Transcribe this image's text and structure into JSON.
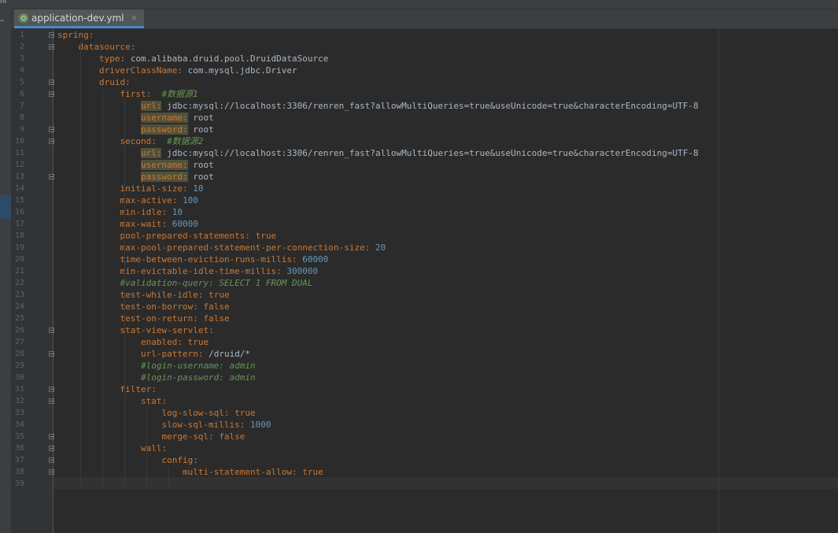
{
  "topbar": {
    "mark": "nl"
  },
  "left_strip": {
    "mark": "–"
  },
  "tab": {
    "title": "application-dev.yml",
    "close_glyph": "×",
    "icon": "spring-leaf-icon",
    "accent": "#4a88c7"
  },
  "colors": {
    "background": "#2b2b2b",
    "key": "#cc7832",
    "string": "#a9b7c6",
    "number": "#6897bb",
    "comment": "#629755",
    "highlight": "#52503a"
  },
  "editor": {
    "lines": [
      {
        "ln": "1",
        "parts": [
          {
            "t": "spring:",
            "c": "k"
          }
        ]
      },
      {
        "ln": "2",
        "parts": [
          {
            "t": "    ",
            "c": "v"
          },
          {
            "t": "datasource:",
            "c": "k"
          }
        ]
      },
      {
        "ln": "3",
        "parts": [
          {
            "t": "        ",
            "c": "v"
          },
          {
            "t": "type:",
            "c": "k"
          },
          {
            "t": " com.alibaba.druid.pool.DruidDataSource",
            "c": "v"
          }
        ]
      },
      {
        "ln": "4",
        "parts": [
          {
            "t": "        ",
            "c": "v"
          },
          {
            "t": "driverClassName:",
            "c": "k"
          },
          {
            "t": " com.mysql.jdbc.Driver",
            "c": "v"
          }
        ]
      },
      {
        "ln": "5",
        "parts": [
          {
            "t": "        ",
            "c": "v"
          },
          {
            "t": "druid:",
            "c": "k"
          }
        ]
      },
      {
        "ln": "6",
        "parts": [
          {
            "t": "            ",
            "c": "v"
          },
          {
            "t": "first:",
            "c": "k"
          },
          {
            "t": "  ",
            "c": "v"
          },
          {
            "t": "#数据源1",
            "c": "c"
          }
        ]
      },
      {
        "ln": "7",
        "parts": [
          {
            "t": "                ",
            "c": "v"
          },
          {
            "t": "url:",
            "c": "k hl"
          },
          {
            "t": " jdbc:mysql://localhost:3306/renren_fast?allowMultiQueries=true&useUnicode=true&characterEncoding=UTF-8",
            "c": "v"
          }
        ]
      },
      {
        "ln": "8",
        "parts": [
          {
            "t": "                ",
            "c": "v"
          },
          {
            "t": "username:",
            "c": "k hl"
          },
          {
            "t": " root",
            "c": "v"
          }
        ]
      },
      {
        "ln": "9",
        "parts": [
          {
            "t": "                ",
            "c": "v"
          },
          {
            "t": "password:",
            "c": "k hl"
          },
          {
            "t": " root",
            "c": "v"
          }
        ]
      },
      {
        "ln": "10",
        "parts": [
          {
            "t": "            ",
            "c": "v"
          },
          {
            "t": "second:",
            "c": "k"
          },
          {
            "t": "  ",
            "c": "v"
          },
          {
            "t": "#数据源2",
            "c": "c"
          }
        ]
      },
      {
        "ln": "11",
        "parts": [
          {
            "t": "                ",
            "c": "v"
          },
          {
            "t": "url:",
            "c": "k hl"
          },
          {
            "t": " jdbc:mysql://localhost:3306/renren_fast?allowMultiQueries=true&useUnicode=true&characterEncoding=UTF-8",
            "c": "v"
          }
        ]
      },
      {
        "ln": "12",
        "parts": [
          {
            "t": "                ",
            "c": "v"
          },
          {
            "t": "username:",
            "c": "k hl"
          },
          {
            "t": " root",
            "c": "v"
          }
        ]
      },
      {
        "ln": "13",
        "parts": [
          {
            "t": "                ",
            "c": "v"
          },
          {
            "t": "password:",
            "c": "k hl"
          },
          {
            "t": " root",
            "c": "v"
          }
        ]
      },
      {
        "ln": "14",
        "parts": [
          {
            "t": "            ",
            "c": "v"
          },
          {
            "t": "initial-size:",
            "c": "k"
          },
          {
            "t": " ",
            "c": "v"
          },
          {
            "t": "10",
            "c": "n"
          }
        ]
      },
      {
        "ln": "15",
        "parts": [
          {
            "t": "            ",
            "c": "v"
          },
          {
            "t": "max-active:",
            "c": "k"
          },
          {
            "t": " ",
            "c": "v"
          },
          {
            "t": "100",
            "c": "n"
          }
        ]
      },
      {
        "ln": "16",
        "parts": [
          {
            "t": "            ",
            "c": "v"
          },
          {
            "t": "min-idle:",
            "c": "k"
          },
          {
            "t": " ",
            "c": "v"
          },
          {
            "t": "10",
            "c": "n"
          }
        ]
      },
      {
        "ln": "17",
        "parts": [
          {
            "t": "            ",
            "c": "v"
          },
          {
            "t": "max-wait:",
            "c": "k"
          },
          {
            "t": " ",
            "c": "v"
          },
          {
            "t": "60000",
            "c": "n"
          }
        ]
      },
      {
        "ln": "18",
        "parts": [
          {
            "t": "            ",
            "c": "v"
          },
          {
            "t": "pool-prepared-statements:",
            "c": "k"
          },
          {
            "t": " ",
            "c": "v"
          },
          {
            "t": "true",
            "c": "k"
          }
        ]
      },
      {
        "ln": "19",
        "parts": [
          {
            "t": "            ",
            "c": "v"
          },
          {
            "t": "max-pool-prepared-statement-per-connection-size:",
            "c": "k"
          },
          {
            "t": " ",
            "c": "v"
          },
          {
            "t": "20",
            "c": "n"
          }
        ]
      },
      {
        "ln": "20",
        "parts": [
          {
            "t": "            ",
            "c": "v"
          },
          {
            "t": "time-between-eviction-runs-millis:",
            "c": "k"
          },
          {
            "t": " ",
            "c": "v"
          },
          {
            "t": "60000",
            "c": "n"
          }
        ]
      },
      {
        "ln": "21",
        "parts": [
          {
            "t": "            ",
            "c": "v"
          },
          {
            "t": "min-evictable-idle-time-millis:",
            "c": "k"
          },
          {
            "t": " ",
            "c": "v"
          },
          {
            "t": "300000",
            "c": "n"
          }
        ]
      },
      {
        "ln": "22",
        "parts": [
          {
            "t": "            ",
            "c": "v"
          },
          {
            "t": "#validation-query: SELECT 1 FROM DUAL",
            "c": "c"
          }
        ]
      },
      {
        "ln": "23",
        "parts": [
          {
            "t": "            ",
            "c": "v"
          },
          {
            "t": "test-while-idle:",
            "c": "k"
          },
          {
            "t": " ",
            "c": "v"
          },
          {
            "t": "true",
            "c": "k"
          }
        ]
      },
      {
        "ln": "24",
        "parts": [
          {
            "t": "            ",
            "c": "v"
          },
          {
            "t": "test-on-borrow:",
            "c": "k"
          },
          {
            "t": " ",
            "c": "v"
          },
          {
            "t": "false",
            "c": "k"
          }
        ]
      },
      {
        "ln": "25",
        "parts": [
          {
            "t": "            ",
            "c": "v"
          },
          {
            "t": "test-on-return:",
            "c": "k"
          },
          {
            "t": " ",
            "c": "v"
          },
          {
            "t": "false",
            "c": "k"
          }
        ]
      },
      {
        "ln": "26",
        "parts": [
          {
            "t": "            ",
            "c": "v"
          },
          {
            "t": "stat-view-servlet:",
            "c": "k"
          }
        ]
      },
      {
        "ln": "27",
        "parts": [
          {
            "t": "                ",
            "c": "v"
          },
          {
            "t": "enabled:",
            "c": "k"
          },
          {
            "t": " ",
            "c": "v"
          },
          {
            "t": "true",
            "c": "k"
          }
        ]
      },
      {
        "ln": "28",
        "parts": [
          {
            "t": "                ",
            "c": "v"
          },
          {
            "t": "url-pattern:",
            "c": "k"
          },
          {
            "t": " /druid/*",
            "c": "v"
          }
        ]
      },
      {
        "ln": "29",
        "parts": [
          {
            "t": "                ",
            "c": "v"
          },
          {
            "t": "#login-username: admin",
            "c": "c"
          }
        ]
      },
      {
        "ln": "30",
        "parts": [
          {
            "t": "                ",
            "c": "v"
          },
          {
            "t": "#login-password: admin",
            "c": "c"
          }
        ]
      },
      {
        "ln": "31",
        "parts": [
          {
            "t": "            ",
            "c": "v"
          },
          {
            "t": "filter:",
            "c": "k"
          }
        ]
      },
      {
        "ln": "32",
        "parts": [
          {
            "t": "                ",
            "c": "v"
          },
          {
            "t": "stat:",
            "c": "k"
          }
        ]
      },
      {
        "ln": "33",
        "parts": [
          {
            "t": "                    ",
            "c": "v"
          },
          {
            "t": "log-slow-sql:",
            "c": "k"
          },
          {
            "t": " ",
            "c": "v"
          },
          {
            "t": "true",
            "c": "k"
          }
        ]
      },
      {
        "ln": "34",
        "parts": [
          {
            "t": "                    ",
            "c": "v"
          },
          {
            "t": "slow-sql-millis:",
            "c": "k"
          },
          {
            "t": " ",
            "c": "v"
          },
          {
            "t": "1000",
            "c": "n"
          }
        ]
      },
      {
        "ln": "35",
        "parts": [
          {
            "t": "                    ",
            "c": "v"
          },
          {
            "t": "merge-sql:",
            "c": "k"
          },
          {
            "t": " ",
            "c": "v"
          },
          {
            "t": "false",
            "c": "k"
          }
        ]
      },
      {
        "ln": "36",
        "parts": [
          {
            "t": "                ",
            "c": "v"
          },
          {
            "t": "wall:",
            "c": "k"
          }
        ]
      },
      {
        "ln": "37",
        "parts": [
          {
            "t": "                    ",
            "c": "v"
          },
          {
            "t": "config:",
            "c": "k"
          }
        ]
      },
      {
        "ln": "38",
        "parts": [
          {
            "t": "                        ",
            "c": "v"
          },
          {
            "t": "multi-statement-allow:",
            "c": "k"
          },
          {
            "t": " ",
            "c": "v"
          },
          {
            "t": "true",
            "c": "k"
          }
        ]
      },
      {
        "ln": "39",
        "parts": []
      }
    ],
    "fold_lines": [
      1,
      2,
      5,
      6,
      9,
      10,
      13,
      26,
      28,
      31,
      32,
      35,
      36,
      37,
      38
    ]
  }
}
